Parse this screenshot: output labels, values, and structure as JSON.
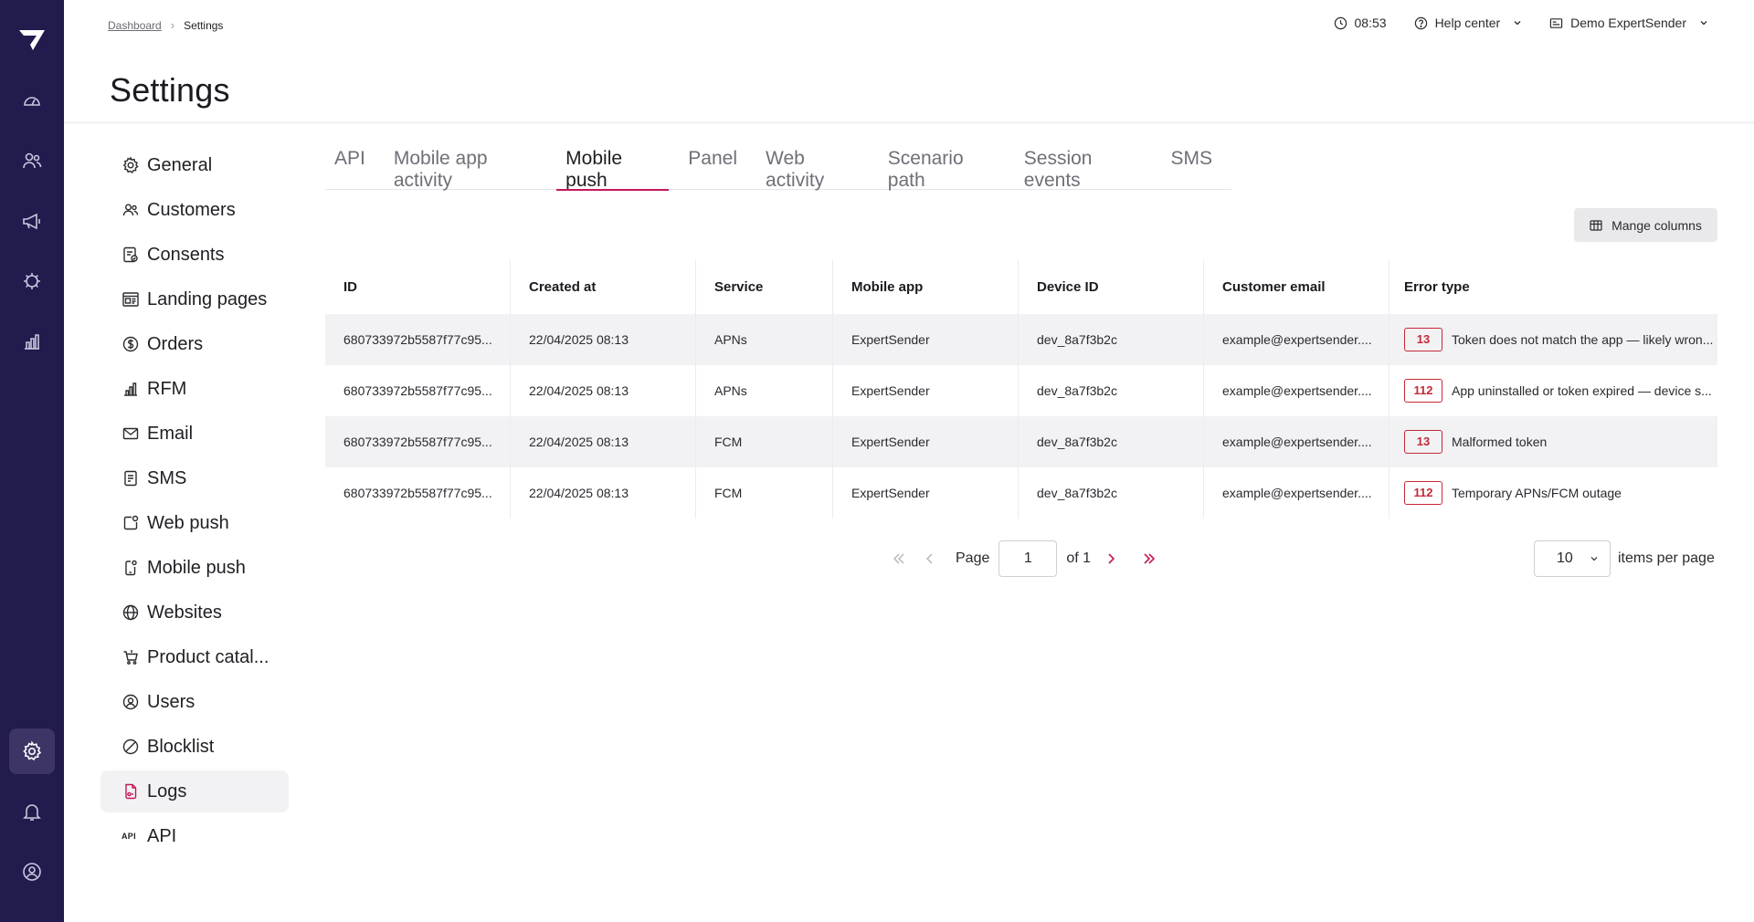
{
  "rail": {
    "items": [
      "dashboard-icon",
      "customers-icon",
      "campaigns-icon",
      "automation-icon",
      "analytics-icon"
    ],
    "active_item": "settings-icon",
    "bottom_items": [
      "settings-icon",
      "notifications-icon",
      "profile-icon"
    ]
  },
  "breadcrumb": {
    "parent": "Dashboard",
    "current": "Settings"
  },
  "topbar": {
    "time": "08:53",
    "help": "Help center",
    "account": "Demo ExpertSender"
  },
  "page": {
    "title": "Settings"
  },
  "subnav": {
    "items": [
      {
        "label": "General",
        "icon": "gear-icon"
      },
      {
        "label": "Customers",
        "icon": "users-icon"
      },
      {
        "label": "Consents",
        "icon": "consent-icon"
      },
      {
        "label": "Landing pages",
        "icon": "landing-page-icon"
      },
      {
        "label": "Orders",
        "icon": "dollar-icon"
      },
      {
        "label": "RFM",
        "icon": "bar-chart-icon"
      },
      {
        "label": "Email",
        "icon": "envelope-icon"
      },
      {
        "label": "SMS",
        "icon": "sms-icon"
      },
      {
        "label": "Web push",
        "icon": "web-push-icon"
      },
      {
        "label": "Mobile push",
        "icon": "mobile-push-icon"
      },
      {
        "label": "Websites",
        "icon": "globe-icon"
      },
      {
        "label": "Product catal...",
        "icon": "cart-icon"
      },
      {
        "label": "Users",
        "icon": "user-circle-icon"
      },
      {
        "label": "Blocklist",
        "icon": "block-icon"
      },
      {
        "label": "Logs",
        "icon": "logs-icon"
      },
      {
        "label": "API",
        "icon": "api-icon",
        "mini": "API"
      }
    ],
    "active": "Logs"
  },
  "tabs": {
    "items": [
      "API",
      "Mobile app activity",
      "Mobile push",
      "Panel",
      "Web activity",
      "Scenario path",
      "Session events",
      "SMS"
    ],
    "active": "Mobile push"
  },
  "toolbar": {
    "manage_columns": "Mange columns"
  },
  "table": {
    "columns": [
      "ID",
      "Created at",
      "Service",
      "Mobile app",
      "Device ID",
      "Customer email",
      "Error type"
    ],
    "rows": [
      {
        "id": "680733972b5587f77c95...",
        "created": "22/04/2025 08:13",
        "service": "APNs",
        "app": "ExpertSender",
        "device": "dev_8a7f3b2c",
        "email": "example@expertsender....",
        "code": "13",
        "error": "Token does not match the app — likely wron..."
      },
      {
        "id": "680733972b5587f77c95...",
        "created": "22/04/2025 08:13",
        "service": "APNs",
        "app": "ExpertSender",
        "device": "dev_8a7f3b2c",
        "email": "example@expertsender....",
        "code": "112",
        "error": "App uninstalled or token expired — device s..."
      },
      {
        "id": "680733972b5587f77c95...",
        "created": "22/04/2025 08:13",
        "service": "FCM",
        "app": "ExpertSender",
        "device": "dev_8a7f3b2c",
        "email": "example@expertsender....",
        "code": "13",
        "error": "Malformed token"
      },
      {
        "id": "680733972b5587f77c95...",
        "created": "22/04/2025 08:13",
        "service": "FCM",
        "app": "ExpertSender",
        "device": "dev_8a7f3b2c",
        "email": "example@expertsender....",
        "code": "112",
        "error": "Temporary APNs/FCM outage"
      }
    ]
  },
  "pagination": {
    "page_label": "Page",
    "current_page": "1",
    "of_label": "of 1",
    "per_page": "10",
    "per_page_label": "items per page"
  },
  "colors": {
    "rail_bg": "#221b4d",
    "accent": "#c2185b",
    "error": "#c62838"
  }
}
